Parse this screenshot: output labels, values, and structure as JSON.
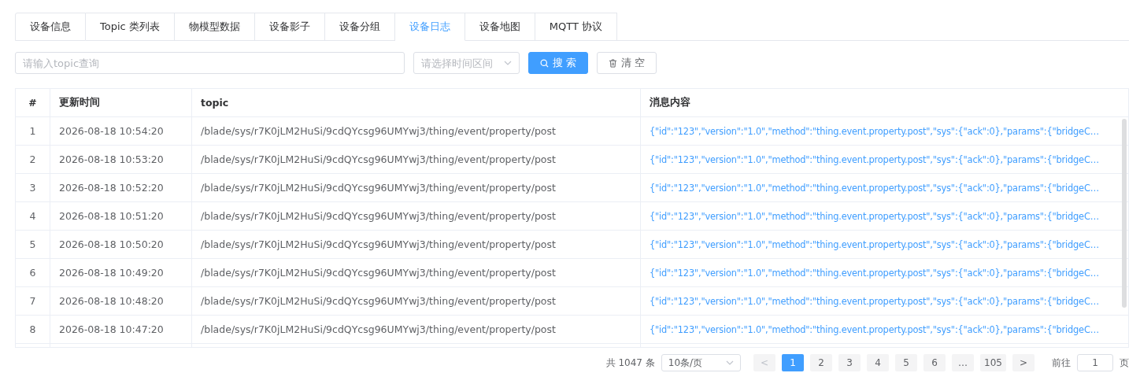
{
  "tabs": [
    {
      "label": "设备信息",
      "selected": false
    },
    {
      "label": "Topic 类列表",
      "selected": false
    },
    {
      "label": "物模型数据",
      "selected": false
    },
    {
      "label": "设备影子",
      "selected": false
    },
    {
      "label": "设备分组",
      "selected": false
    },
    {
      "label": "设备日志",
      "selected": true
    },
    {
      "label": "设备地图",
      "selected": false
    },
    {
      "label": "MQTT 协议",
      "selected": false
    }
  ],
  "filters": {
    "topic": {
      "placeholder": "请输入topic查询"
    },
    "time_range": {
      "placeholder": "请选择时间区间"
    },
    "search_button": "搜 索",
    "clear_button": "清 空"
  },
  "table": {
    "columns": [
      "#",
      "更新时间",
      "topic",
      "消息内容"
    ],
    "rows": [
      [
        "1",
        "2026-08-18 10:54:20",
        "/blade/sys/r7K0jLM2HuSi/9cdQYcsg96UMYwj3/thing/event/property/post",
        "{\"id\":\"123\",\"version\":\"1.0\",\"method\":\"thing.event.property.post\",\"sys\":{\"ack\":0},\"params\":{\"bridgeC…"
      ],
      [
        "2",
        "2026-08-18 10:53:20",
        "/blade/sys/r7K0jLM2HuSi/9cdQYcsg96UMYwj3/thing/event/property/post",
        "{\"id\":\"123\",\"version\":\"1.0\",\"method\":\"thing.event.property.post\",\"sys\":{\"ack\":0},\"params\":{\"bridgeC…"
      ],
      [
        "3",
        "2026-08-18 10:52:20",
        "/blade/sys/r7K0jLM2HuSi/9cdQYcsg96UMYwj3/thing/event/property/post",
        "{\"id\":\"123\",\"version\":\"1.0\",\"method\":\"thing.event.property.post\",\"sys\":{\"ack\":0},\"params\":{\"bridgeC…"
      ],
      [
        "4",
        "2026-08-18 10:51:20",
        "/blade/sys/r7K0jLM2HuSi/9cdQYcsg96UMYwj3/thing/event/property/post",
        "{\"id\":\"123\",\"version\":\"1.0\",\"method\":\"thing.event.property.post\",\"sys\":{\"ack\":0},\"params\":{\"bridgeC…"
      ],
      [
        "5",
        "2026-08-18 10:50:20",
        "/blade/sys/r7K0jLM2HuSi/9cdQYcsg96UMYwj3/thing/event/property/post",
        "{\"id\":\"123\",\"version\":\"1.0\",\"method\":\"thing.event.property.post\",\"sys\":{\"ack\":0},\"params\":{\"bridgeC…"
      ],
      [
        "6",
        "2026-08-18 10:49:20",
        "/blade/sys/r7K0jLM2HuSi/9cdQYcsg96UMYwj3/thing/event/property/post",
        "{\"id\":\"123\",\"version\":\"1.0\",\"method\":\"thing.event.property.post\",\"sys\":{\"ack\":0},\"params\":{\"bridgeC…"
      ],
      [
        "7",
        "2026-08-18 10:48:20",
        "/blade/sys/r7K0jLM2HuSi/9cdQYcsg96UMYwj3/thing/event/property/post",
        "{\"id\":\"123\",\"version\":\"1.0\",\"method\":\"thing.event.property.post\",\"sys\":{\"ack\":0},\"params\":{\"bridgeC…"
      ],
      [
        "8",
        "2026-08-18 10:47:20",
        "/blade/sys/r7K0jLM2HuSi/9cdQYcsg96UMYwj3/thing/event/property/post",
        "{\"id\":\"123\",\"version\":\"1.0\",\"method\":\"thing.event.property.post\",\"sys\":{\"ack\":0},\"params\":{\"bridgeC…"
      ]
    ]
  },
  "pagination": {
    "total": "共 1047 条",
    "page_size": "10条/页",
    "prev": "<",
    "pages": [
      {
        "label": "1",
        "selected": true
      },
      {
        "label": "2",
        "selected": false
      },
      {
        "label": "3",
        "selected": false
      },
      {
        "label": "4",
        "selected": false
      },
      {
        "label": "5",
        "selected": false
      },
      {
        "label": "6",
        "selected": false
      },
      {
        "label": "…",
        "selected": false
      },
      {
        "label": "105",
        "selected": false
      }
    ],
    "next": ">",
    "goto_label": "前往",
    "goto_value": "1",
    "goto_suffix": "页"
  }
}
